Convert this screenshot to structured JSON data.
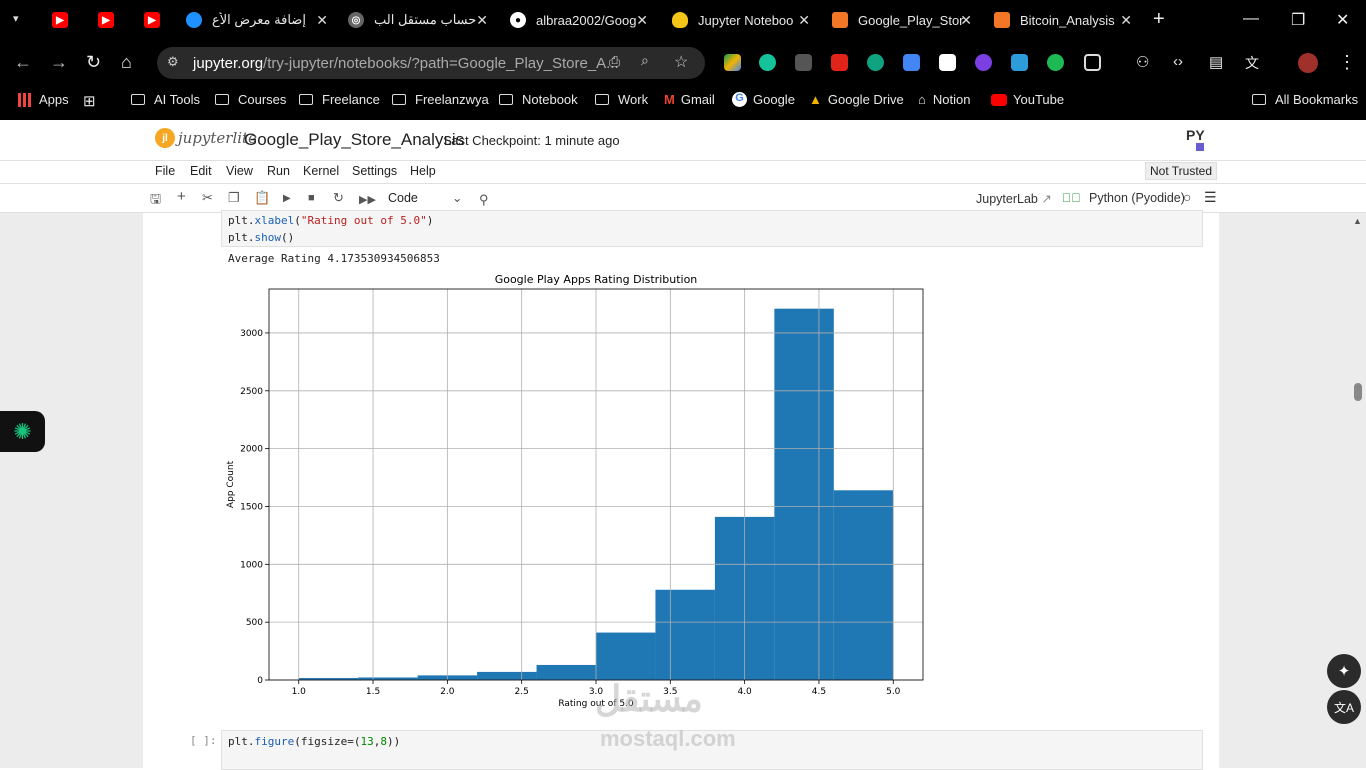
{
  "browser": {
    "tabs": [
      {
        "title": "",
        "icon": "youtube-icon"
      },
      {
        "title": "",
        "icon": "youtube-icon"
      },
      {
        "title": "",
        "icon": "youtube-icon"
      },
      {
        "title": "إضافة معرض الأع",
        "icon": "mostaql-icon"
      },
      {
        "title": "حساب مستقل الب",
        "icon": "openai-icon"
      },
      {
        "title": "albraa2002/Goog",
        "icon": "github-icon"
      },
      {
        "title": "Jupyter Noteboo",
        "icon": "jupyter-bulb-icon"
      },
      {
        "title": "Google_Play_Stor",
        "icon": "notebook-icon"
      },
      {
        "title": "Bitcoin_Analysis",
        "icon": "notebook-icon"
      }
    ],
    "url_host": "jupyter.org",
    "url_path": "/try-jupyter/notebooks/?path=Google_Play_Store_A...",
    "bookmarks": [
      "Apps",
      "AI Tools",
      "Courses",
      "Freelance",
      "Freelanzwya",
      "Notebook",
      "Work",
      "Gmail",
      "Google",
      "Google Drive",
      "Notion",
      "YouTube"
    ],
    "all_bookmarks": "All Bookmarks"
  },
  "jupyter": {
    "logo_text": "jupyterlite",
    "logo_badge": "jl",
    "py_logo": "PY",
    "notebook_name": "Google_Play_Store_Analysis",
    "checkpoint": "Last Checkpoint: 1 minute ago",
    "menu": [
      "File",
      "Edit",
      "View",
      "Run",
      "Kernel",
      "Settings",
      "Help"
    ],
    "trust": "Not Trusted",
    "cell_type": "Code",
    "jupyterlab_link": "JupyterLab",
    "kernel": "Python (Pyodide)"
  },
  "cells": {
    "code1_line1_a": "plt.",
    "code1_line1_fn": "xlabel",
    "code1_line1_b": "(",
    "code1_line1_str": "\"Rating out of 5.0\"",
    "code1_line1_c": ")",
    "code1_line2_a": "plt.",
    "code1_line2_fn": "show",
    "code1_line2_b": "()",
    "output_text": "Average Rating 4.173530934506853",
    "next_prompt": "[ ]:",
    "code2_a": "plt.",
    "code2_fn": "figure",
    "code2_b": "(figsize=(",
    "code2_n1": "13",
    "code2_c": ",",
    "code2_n2": "8",
    "code2_d": "))"
  },
  "watermark": {
    "arabic": "مستقل",
    "latin": "mostaql.com"
  },
  "chart_data": {
    "type": "bar",
    "title": "Google Play Apps Rating Distribution",
    "xlabel": "Rating out of 5.0",
    "ylabel": "App Count",
    "bin_edges": [
      1.0,
      1.4,
      1.8,
      2.2,
      2.6,
      3.0,
      3.4,
      3.8,
      4.2,
      4.6,
      5.0
    ],
    "values": [
      17,
      22,
      40,
      70,
      130,
      410,
      780,
      1410,
      3210,
      1640
    ],
    "xlim": [
      0.8,
      5.2
    ],
    "ylim": [
      0,
      3380
    ],
    "xticks": [
      1.0,
      1.5,
      2.0,
      2.5,
      3.0,
      3.5,
      4.0,
      4.5,
      5.0
    ],
    "xtick_labels": [
      "1.0",
      "1.5",
      "2.0",
      "2.5",
      "3.0",
      "3.5",
      "4.0",
      "4.5",
      "5.0"
    ],
    "yticks": [
      0,
      500,
      1000,
      1500,
      2000,
      2500,
      3000
    ],
    "ytick_labels": [
      "0",
      "500",
      "1000",
      "1500",
      "2000",
      "2500",
      "3000"
    ],
    "grid": true,
    "bar_color": "#1f77b4"
  }
}
